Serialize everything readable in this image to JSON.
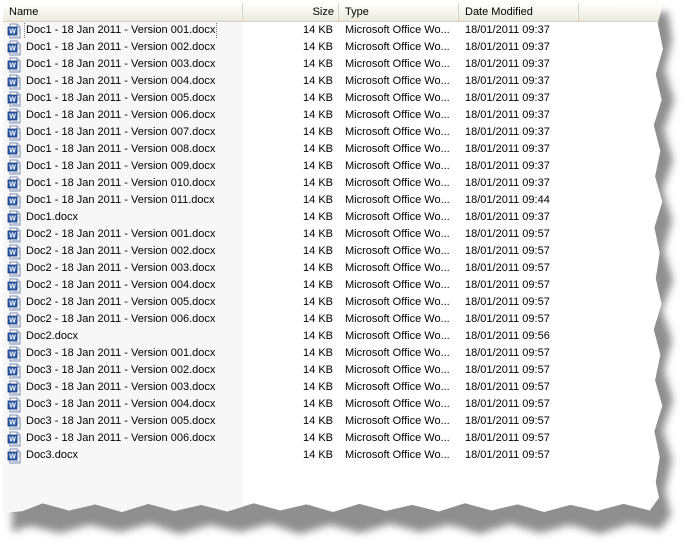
{
  "columns": {
    "name": "Name",
    "size": "Size",
    "type": "Type",
    "date": "Date Modified"
  },
  "files": [
    {
      "name": "Doc1 - 18 Jan 2011 - Version 001.docx",
      "size": "14 KB",
      "type": "Microsoft Office Wo...",
      "date": "18/01/2011 09:37",
      "icon": "word-document-icon"
    },
    {
      "name": "Doc1 - 18 Jan 2011 - Version 002.docx",
      "size": "14 KB",
      "type": "Microsoft Office Wo...",
      "date": "18/01/2011 09:37",
      "icon": "word-document-icon"
    },
    {
      "name": "Doc1 - 18 Jan 2011 - Version 003.docx",
      "size": "14 KB",
      "type": "Microsoft Office Wo...",
      "date": "18/01/2011 09:37",
      "icon": "word-document-icon"
    },
    {
      "name": "Doc1 - 18 Jan 2011 - Version 004.docx",
      "size": "14 KB",
      "type": "Microsoft Office Wo...",
      "date": "18/01/2011 09:37",
      "icon": "word-document-icon"
    },
    {
      "name": "Doc1 - 18 Jan 2011 - Version 005.docx",
      "size": "14 KB",
      "type": "Microsoft Office Wo...",
      "date": "18/01/2011 09:37",
      "icon": "word-document-icon"
    },
    {
      "name": "Doc1 - 18 Jan 2011 - Version 006.docx",
      "size": "14 KB",
      "type": "Microsoft Office Wo...",
      "date": "18/01/2011 09:37",
      "icon": "word-document-icon"
    },
    {
      "name": "Doc1 - 18 Jan 2011 - Version 007.docx",
      "size": "14 KB",
      "type": "Microsoft Office Wo...",
      "date": "18/01/2011 09:37",
      "icon": "word-document-icon"
    },
    {
      "name": "Doc1 - 18 Jan 2011 - Version 008.docx",
      "size": "14 KB",
      "type": "Microsoft Office Wo...",
      "date": "18/01/2011 09:37",
      "icon": "word-document-icon"
    },
    {
      "name": "Doc1 - 18 Jan 2011 - Version 009.docx",
      "size": "14 KB",
      "type": "Microsoft Office Wo...",
      "date": "18/01/2011 09:37",
      "icon": "word-document-icon"
    },
    {
      "name": "Doc1 - 18 Jan 2011 - Version 010.docx",
      "size": "14 KB",
      "type": "Microsoft Office Wo...",
      "date": "18/01/2011 09:37",
      "icon": "word-document-icon"
    },
    {
      "name": "Doc1 - 18 Jan 2011 - Version 011.docx",
      "size": "14 KB",
      "type": "Microsoft Office Wo...",
      "date": "18/01/2011 09:44",
      "icon": "word-document-icon"
    },
    {
      "name": "Doc1.docx",
      "size": "14 KB",
      "type": "Microsoft Office Wo...",
      "date": "18/01/2011 09:37",
      "icon": "word-document-icon"
    },
    {
      "name": "Doc2 - 18 Jan 2011 - Version 001.docx",
      "size": "14 KB",
      "type": "Microsoft Office Wo...",
      "date": "18/01/2011 09:57",
      "icon": "word-document-icon"
    },
    {
      "name": "Doc2 - 18 Jan 2011 - Version 002.docx",
      "size": "14 KB",
      "type": "Microsoft Office Wo...",
      "date": "18/01/2011 09:57",
      "icon": "word-document-icon"
    },
    {
      "name": "Doc2 - 18 Jan 2011 - Version 003.docx",
      "size": "14 KB",
      "type": "Microsoft Office Wo...",
      "date": "18/01/2011 09:57",
      "icon": "word-document-icon"
    },
    {
      "name": "Doc2 - 18 Jan 2011 - Version 004.docx",
      "size": "14 KB",
      "type": "Microsoft Office Wo...",
      "date": "18/01/2011 09:57",
      "icon": "word-document-icon"
    },
    {
      "name": "Doc2 - 18 Jan 2011 - Version 005.docx",
      "size": "14 KB",
      "type": "Microsoft Office Wo...",
      "date": "18/01/2011 09:57",
      "icon": "word-document-icon"
    },
    {
      "name": "Doc2 - 18 Jan 2011 - Version 006.docx",
      "size": "14 KB",
      "type": "Microsoft Office Wo...",
      "date": "18/01/2011 09:57",
      "icon": "word-document-icon"
    },
    {
      "name": "Doc2.docx",
      "size": "14 KB",
      "type": "Microsoft Office Wo...",
      "date": "18/01/2011 09:56",
      "icon": "word-document-icon"
    },
    {
      "name": "Doc3 - 18 Jan 2011 - Version 001.docx",
      "size": "14 KB",
      "type": "Microsoft Office Wo...",
      "date": "18/01/2011 09:57",
      "icon": "word-document-icon"
    },
    {
      "name": "Doc3 - 18 Jan 2011 - Version 002.docx",
      "size": "14 KB",
      "type": "Microsoft Office Wo...",
      "date": "18/01/2011 09:57",
      "icon": "word-document-icon"
    },
    {
      "name": "Doc3 - 18 Jan 2011 - Version 003.docx",
      "size": "14 KB",
      "type": "Microsoft Office Wo...",
      "date": "18/01/2011 09:57",
      "icon": "word-document-icon"
    },
    {
      "name": "Doc3 - 18 Jan 2011 - Version 004.docx",
      "size": "14 KB",
      "type": "Microsoft Office Wo...",
      "date": "18/01/2011 09:57",
      "icon": "word-document-icon"
    },
    {
      "name": "Doc3 - 18 Jan 2011 - Version 005.docx",
      "size": "14 KB",
      "type": "Microsoft Office Wo...",
      "date": "18/01/2011 09:57",
      "icon": "word-document-icon"
    },
    {
      "name": "Doc3 - 18 Jan 2011 - Version 006.docx",
      "size": "14 KB",
      "type": "Microsoft Office Wo...",
      "date": "18/01/2011 09:57",
      "icon": "word-document-icon"
    },
    {
      "name": "Doc3.docx",
      "size": "14 KB",
      "type": "Microsoft Office Wo...",
      "date": "18/01/2011 09:57",
      "icon": "word-document-icon"
    }
  ],
  "selected_index": 0,
  "colors": {
    "header_border": "#d6d2c2",
    "sorted_column_bg": "#f7f7f7",
    "icon_blue": "#2b5aa8"
  }
}
